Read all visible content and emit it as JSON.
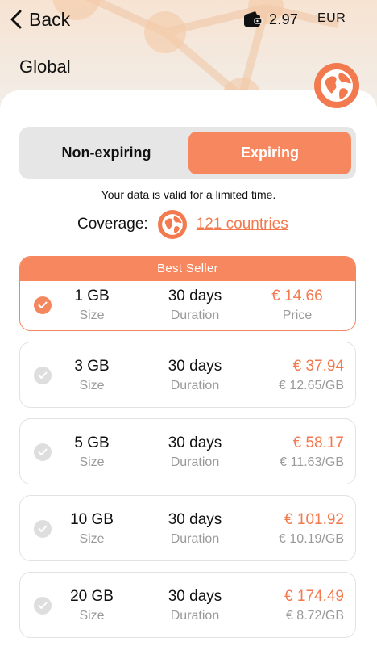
{
  "header": {
    "back_label": "Back",
    "wallet_icon": "wallet-icon",
    "balance": "2.97",
    "currency": "EUR",
    "title": "Global",
    "region_icon": "globe-icon"
  },
  "tabs": {
    "left": "Non-expiring",
    "right": "Expiring",
    "selected": "Expiring"
  },
  "validity_text": "Your data is valid for a limited time.",
  "coverage": {
    "label": "Coverage:",
    "link": "121 countries"
  },
  "colors": {
    "accent": "#f7875e",
    "price": "#f27a4e",
    "muted": "#9a9a9a"
  },
  "plans": [
    {
      "badge": "Best Seller",
      "size": "1 GB",
      "size_label": "Size",
      "duration": "30 days",
      "duration_label": "Duration",
      "price": "€ 14.66",
      "price_sub": "Price",
      "selected": true
    },
    {
      "size": "3 GB",
      "size_label": "Size",
      "duration": "30 days",
      "duration_label": "Duration",
      "price": "€ 37.94",
      "price_sub": "€ 12.65/GB",
      "selected": false
    },
    {
      "size": "5 GB",
      "size_label": "Size",
      "duration": "30 days",
      "duration_label": "Duration",
      "price": "€ 58.17",
      "price_sub": "€ 11.63/GB",
      "selected": false
    },
    {
      "size": "10 GB",
      "size_label": "Size",
      "duration": "30 days",
      "duration_label": "Duration",
      "price": "€ 101.92",
      "price_sub": "€ 10.19/GB",
      "selected": false
    },
    {
      "size": "20 GB",
      "size_label": "Size",
      "duration": "30 days",
      "duration_label": "Duration",
      "price": "€ 174.49",
      "price_sub": "€ 8.72/GB",
      "selected": false
    }
  ]
}
